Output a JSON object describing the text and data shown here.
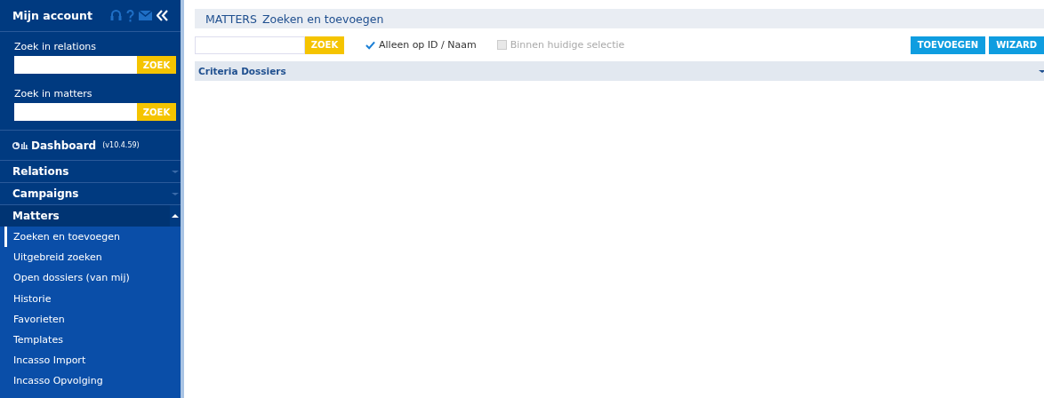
{
  "sidebar": {
    "account_title": "Mijn account",
    "searches": [
      {
        "label": "Zoek in relations",
        "button": "ZOEK"
      },
      {
        "label": "Zoek in matters",
        "button": "ZOEK"
      }
    ],
    "dashboard": {
      "label": "Dashboard",
      "version": "(v10.4.59)"
    },
    "sections": [
      {
        "label": "Relations",
        "expanded": false
      },
      {
        "label": "Campaigns",
        "expanded": false
      },
      {
        "label": "Matters",
        "expanded": true,
        "items": [
          {
            "label": "Zoeken en toevoegen",
            "selected": true
          },
          {
            "label": "Uitgebreid zoeken",
            "selected": false
          },
          {
            "label": "Open dossiers (van mij)",
            "selected": false
          },
          {
            "label": "Historie",
            "selected": false
          },
          {
            "label": "Favorieten",
            "selected": false
          },
          {
            "label": "Templates",
            "selected": false
          },
          {
            "label": "Incasso Import",
            "selected": false
          },
          {
            "label": "Incasso Opvolging",
            "selected": false
          }
        ]
      }
    ]
  },
  "header": {
    "section": "MATTERS",
    "title": "Zoeken en toevoegen"
  },
  "toolbar": {
    "search_button": "ZOEK",
    "checkboxes": [
      {
        "label": "Alleen op ID / Naam",
        "checked": true,
        "disabled": false
      },
      {
        "label": "Binnen huidige selectie",
        "checked": false,
        "disabled": true
      }
    ],
    "buttons": [
      "TOEVOEGEN",
      "WIZARD"
    ]
  },
  "panel": {
    "title": "Criteria Dossiers",
    "expanded": false
  }
}
